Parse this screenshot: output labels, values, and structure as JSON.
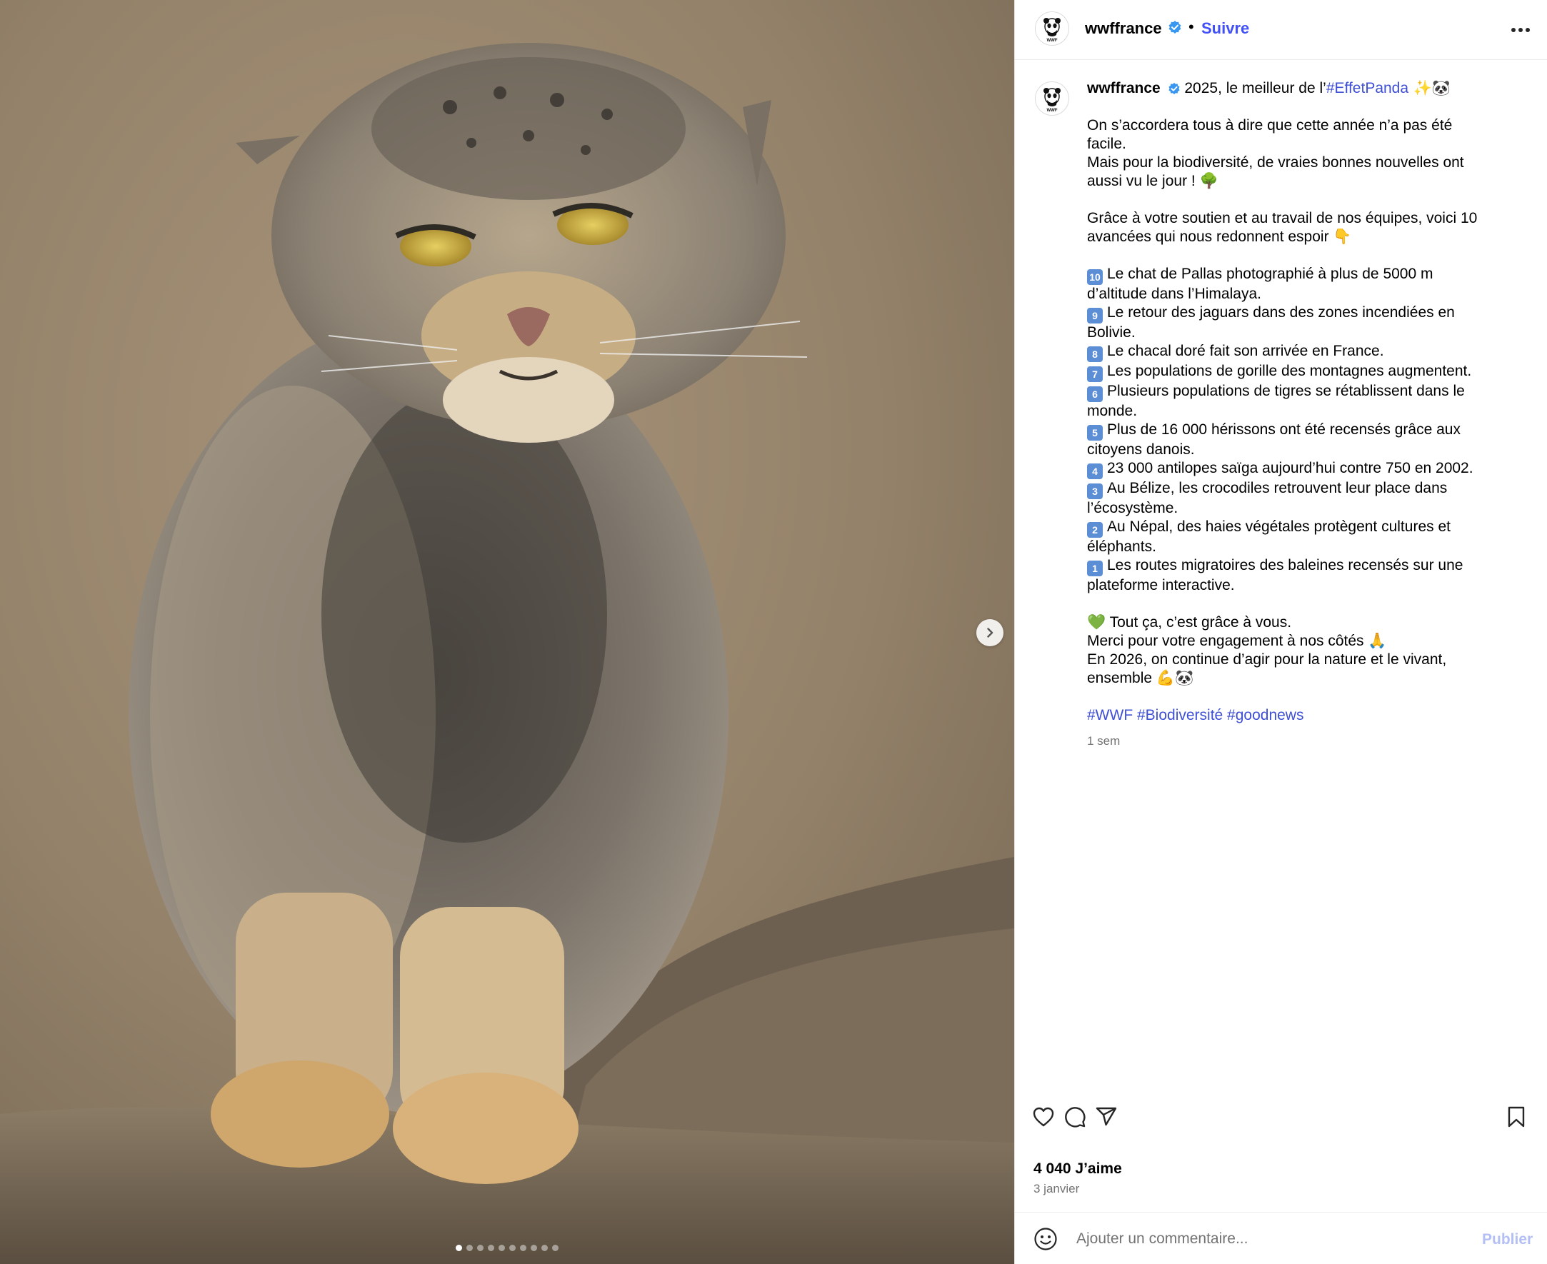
{
  "colors": {
    "link": "#3e4fd6",
    "follow": "#4150f7",
    "verified": "#3897f0",
    "publish_disabled": "#b3bff5",
    "muted": "#737373"
  },
  "header": {
    "username": "wwffrance",
    "avatar_label": "WWF",
    "separator": "•",
    "follow_label": "Suivre",
    "verified_icon": "verified-badge-icon",
    "more_icon": "more-options-icon"
  },
  "media": {
    "next_icon": "chevron-right-icon",
    "carousel": {
      "count": 10,
      "active": 1
    }
  },
  "caption": {
    "username": "wwffrance",
    "intro_text": " 2025, le meilleur de l’",
    "intro_tag": "#EffetPanda",
    "intro_emoji": " ✨🐼",
    "p1": [
      "On s’accordera tous à dire que cette année n’a pas été",
      "facile.",
      "Mais pour la biodiversité, de vraies bonnes nouvelles ont",
      "aussi vu le jour ! 🌳"
    ],
    "p2": [
      "Grâce à votre soutien et au travail de nos équipes, voici 10",
      "avancées qui nous redonnent espoir 👇"
    ],
    "items": [
      {
        "badge": "10",
        "lines": [
          "Le chat de Pallas photographié à plus de 5000 m",
          "d’altitude dans l’Himalaya."
        ]
      },
      {
        "badge": "9",
        "lines": [
          "Le retour des jaguars dans des zones incendiées en",
          "Bolivie."
        ]
      },
      {
        "badge": "8",
        "lines": [
          "Le chacal doré fait son arrivée en France."
        ]
      },
      {
        "badge": "7",
        "lines": [
          "Les populations de gorille des montagnes augmentent."
        ]
      },
      {
        "badge": "6",
        "lines": [
          "Plusieurs populations de tigres se rétablissent dans le",
          "monde."
        ]
      },
      {
        "badge": "5",
        "lines": [
          "Plus de 16 000 hérissons ont été recensés grâce aux",
          "citoyens danois."
        ]
      },
      {
        "badge": "4",
        "lines": [
          "23 000 antilopes saïga aujourd’hui contre 750 en 2002."
        ]
      },
      {
        "badge": "3",
        "lines": [
          "Au Bélize, les crocodiles retrouvent leur place dans",
          "l’écosystème."
        ]
      },
      {
        "badge": "2",
        "lines": [
          "Au Népal, des haies végétales protègent cultures et",
          "éléphants."
        ]
      },
      {
        "badge": "1",
        "lines": [
          "Les routes migratoires des baleines recensés sur une",
          "plateforme interactive."
        ]
      }
    ],
    "p3": [
      "💚 Tout ça, c’est grâce à vous.",
      "Merci pour votre engagement à nos côtés 🙏",
      "En 2026, on continue d’agir pour la nature et le vivant,",
      "ensemble 💪🐼"
    ],
    "hashtags": "#WWF #Biodiversité #goodnews",
    "time_ago": "1 sem"
  },
  "actions": {
    "like_icon": "heart-icon",
    "comment_icon": "comment-icon",
    "share_icon": "share-icon",
    "save_icon": "bookmark-icon"
  },
  "likes": "4 040 J’aime",
  "date": "3 janvier",
  "comment": {
    "emoji_icon": "smiley-icon",
    "placeholder": "Ajouter un commentaire...",
    "publish_label": "Publier"
  }
}
